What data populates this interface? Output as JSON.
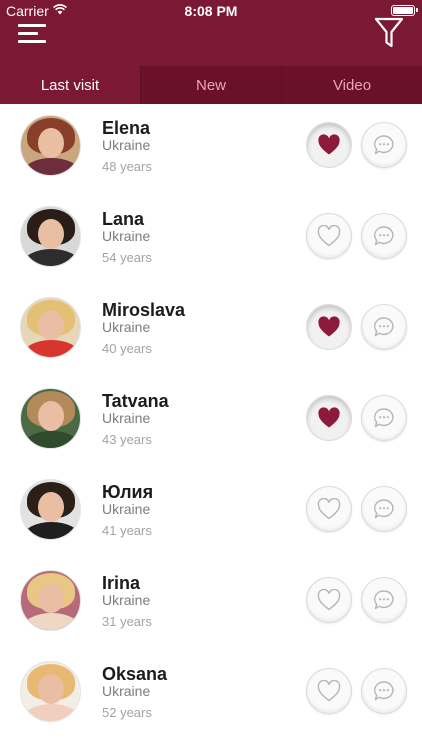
{
  "status_bar": {
    "carrier": "Carrier",
    "time": "8:08 PM"
  },
  "header": {
    "menu_icon": "hamburger-menu-icon",
    "filter_icon": "funnel-filter-icon"
  },
  "colors": {
    "brand": "#7b1834",
    "tab_inactive_bg": "#6a1128",
    "tab_inactive_text": "#e9a7b6",
    "heart_liked": "#8b1a3c",
    "icon_outline": "#b5b5b5"
  },
  "tabs": [
    {
      "label": "Last visit",
      "active": true
    },
    {
      "label": "New",
      "active": false
    },
    {
      "label": "Video",
      "active": false
    }
  ],
  "profiles": [
    {
      "name": "Elena",
      "country": "Ukraine",
      "age": "48 years",
      "liked": true
    },
    {
      "name": "Lana",
      "country": "Ukraine",
      "age": "54 years",
      "liked": false
    },
    {
      "name": "Miroslava",
      "country": "Ukraine",
      "age": "40 years",
      "liked": true
    },
    {
      "name": "Tatvana",
      "country": "Ukraine",
      "age": "43 years",
      "liked": true
    },
    {
      "name": "Юлия",
      "country": "Ukraine",
      "age": "41 years",
      "liked": false
    },
    {
      "name": "Irina",
      "country": "Ukraine",
      "age": "31 years",
      "liked": false
    },
    {
      "name": "Oksana",
      "country": "Ukraine",
      "age": "52 years",
      "liked": false
    }
  ]
}
